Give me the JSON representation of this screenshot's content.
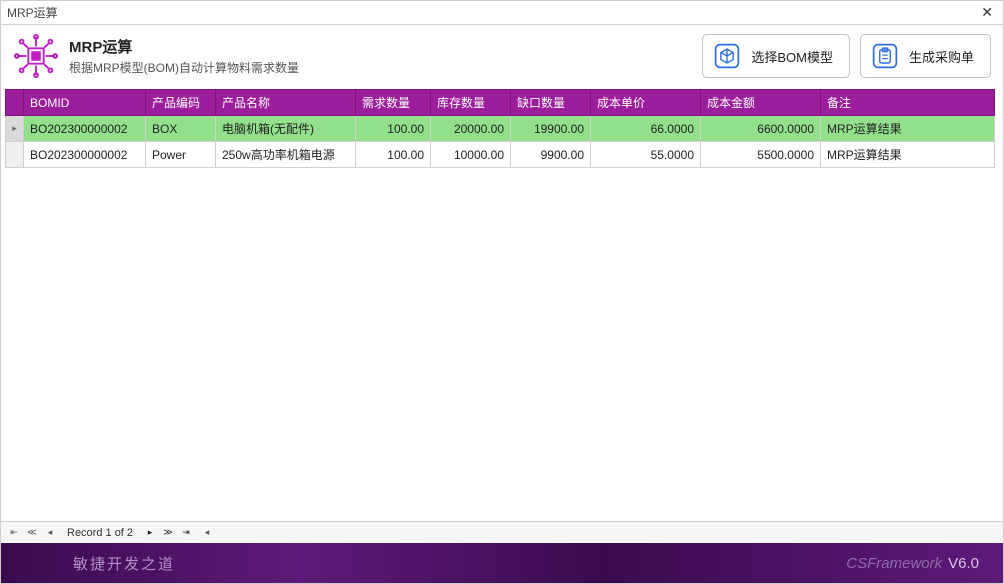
{
  "window": {
    "title": "MRP运算"
  },
  "header": {
    "title": "MRP运算",
    "subtitle": "根据MRP模型(BOM)自动计算物料需求数量"
  },
  "actions": {
    "select_bom": "选择BOM模型",
    "gen_po": "生成采购单"
  },
  "columns": {
    "bomid": "BOMID",
    "prod_code": "产品编码",
    "prod_name": "产品名称",
    "req_qty": "需求数量",
    "stock_qty": "库存数量",
    "short_qty": "缺口数量",
    "cost_price": "成本单价",
    "cost_amount": "成本金额",
    "remark": "备注"
  },
  "rows": [
    {
      "bomid": "BO202300000002",
      "prod_code": "BOX",
      "prod_name": "电脑机箱(无配件)",
      "req_qty": "100.00",
      "stock_qty": "20000.00",
      "short_qty": "19900.00",
      "cost_price": "66.0000",
      "cost_amount": "6600.0000",
      "remark": "MRP运算结果",
      "selected": true
    },
    {
      "bomid": "BO202300000002",
      "prod_code": "Power",
      "prod_name": "250w高功率机箱电源",
      "req_qty": "100.00",
      "stock_qty": "10000.00",
      "short_qty": "9900.00",
      "cost_price": "55.0000",
      "cost_amount": "5500.0000",
      "remark": "MRP运算结果",
      "selected": false
    }
  ],
  "navigator": {
    "status": "Record 1 of 2"
  },
  "footer": {
    "tagline": "敏捷开发之道",
    "brand": "CSFramework",
    "version": "V6.0"
  }
}
